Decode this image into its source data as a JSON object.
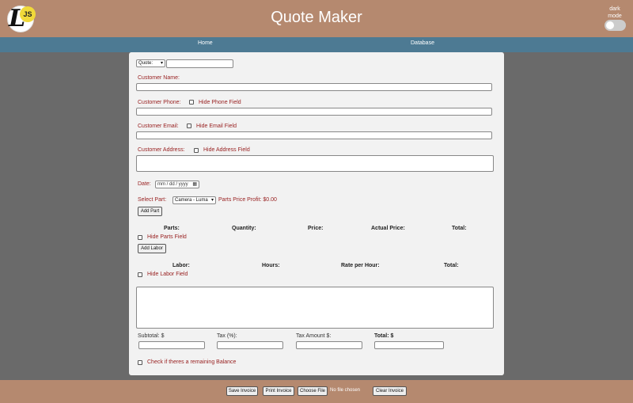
{
  "header": {
    "logo_letter": "L",
    "logo_badge": "JS",
    "title": "Quote Maker",
    "dark_mode_label": "dark mode"
  },
  "nav": {
    "home": "Home",
    "database": "Database"
  },
  "form": {
    "quote_select": "Quote:",
    "quote_input": "",
    "customer_name_label": "Customer Name:",
    "customer_phone_label": "Customer Phone:",
    "hide_phone_label": "Hide Phone Field",
    "customer_email_label": "Customer Email:",
    "hide_email_label": "Hide Email Field",
    "customer_address_label": "Customer Address:",
    "hide_address_label": "Hide Address Field",
    "date_label": "Date:",
    "date_placeholder": "mm / dd / yyyy",
    "select_part_label": "Select Part:",
    "part_selected": "Camera - Luma",
    "parts_price_profit": "Parts Price Profit: $0.00",
    "add_part_button": "Add Part",
    "parts_headers": [
      "Parts:",
      "Quantity:",
      "Price:",
      "Actual Price:",
      "Total:"
    ],
    "hide_parts_label": "Hide Parts Field",
    "add_labor_button": "Add Labor",
    "labor_headers": [
      "Labor:",
      "Hours:",
      "Rate per Hour:",
      "Total:"
    ],
    "hide_labor_label": "Hide Labor Field",
    "notes_value": "",
    "subtotal_label": "Subtotal: $",
    "tax_label": "Tax (%):",
    "tax_amount_label": "Tax Amount $:",
    "total_label": "Total: $",
    "remaining_balance_label": "Check if theres a remaining Balance"
  },
  "footer": {
    "save_invoice": "Save Invoice",
    "print_invoice": "Print Invoice",
    "choose_file": "Choose File",
    "no_file": "No file chosen",
    "clear_invoice": "Clear Invoice"
  },
  "colors": {
    "header_bg": "#b5896f",
    "nav_bg": "#4d7a93",
    "label_red": "#992222",
    "page_bg": "#6a6a6a"
  }
}
